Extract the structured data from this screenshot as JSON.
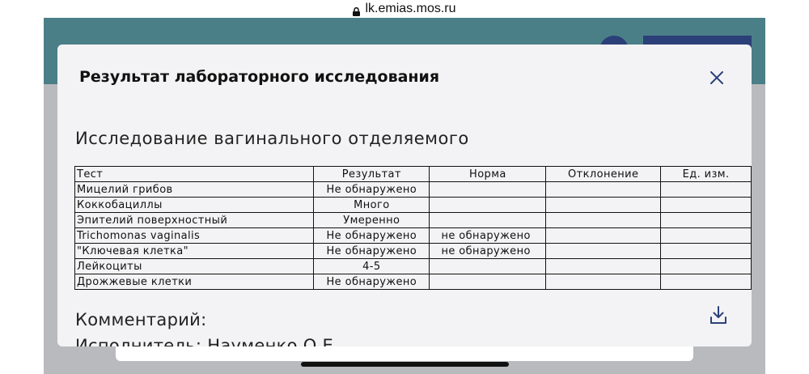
{
  "browser": {
    "url": "lk.emias.mos.ru"
  },
  "colors": {
    "header": "#4b7f87",
    "accent_navy": "#2b3f78",
    "modal_bg": "#f3f3f5"
  },
  "icons": {
    "close": "close-icon",
    "download": "download-icon",
    "lock": "lock-icon"
  },
  "modal": {
    "title": "Результат лабораторного исследования",
    "study_title": "Исследование вагинального отделяемого",
    "table": {
      "headers": [
        "Тест",
        "Результат",
        "Норма",
        "Отклонение",
        "Ед. изм."
      ],
      "rows": [
        [
          "Мицелий грибов",
          "Не обнаружено",
          "",
          "",
          ""
        ],
        [
          "Коккобациллы",
          "Много",
          "",
          "",
          ""
        ],
        [
          "Эпителий поверхностный",
          "Умеренно",
          "",
          "",
          ""
        ],
        [
          "Trichomonas vaginalis",
          "Не обнаружено",
          "не обнаружено",
          "",
          ""
        ],
        [
          "\"Ключевая клетка\"",
          "Не обнаружено",
          "не обнаружено",
          "",
          ""
        ],
        [
          "Лейкоциты",
          "4-5",
          "",
          "",
          ""
        ],
        [
          "Дрожжевые клетки",
          "Не обнаружено",
          "",
          "",
          ""
        ]
      ]
    },
    "comment_label": "Комментарий:",
    "executor_text": "Исполнитель: Науменко О.Е."
  }
}
